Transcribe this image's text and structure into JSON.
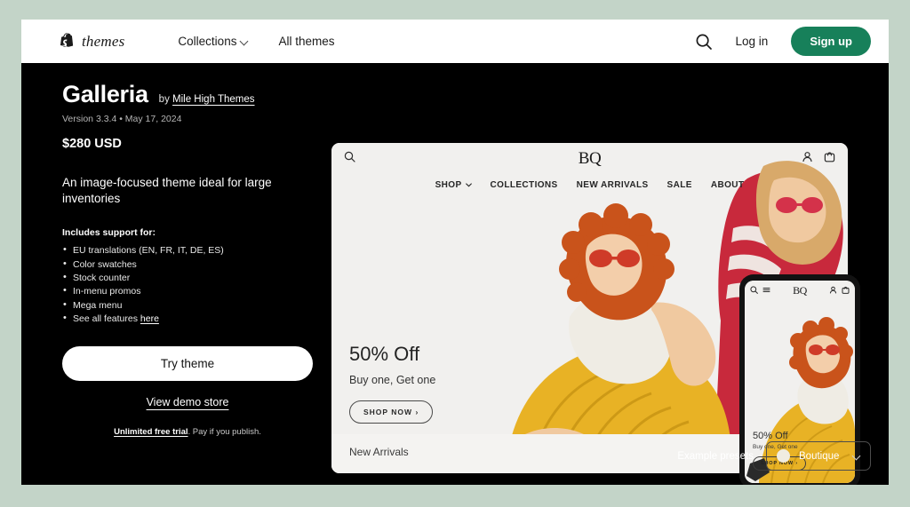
{
  "header": {
    "brand_word": "themes",
    "brand_icon": "shopify-bag-icon",
    "nav": [
      {
        "label": "Collections",
        "has_chevron": true
      },
      {
        "label": "All themes",
        "has_chevron": false
      }
    ],
    "search_icon": "search-icon",
    "login_label": "Log in",
    "signup_label": "Sign up",
    "signup_color": "#17805a"
  },
  "theme": {
    "title": "Galleria",
    "by_prefix": "by",
    "author": "Mile High Themes",
    "version_line": "Version 3.3.4 • May 17, 2024",
    "price": "$280 USD",
    "tagline": "An image-focused theme ideal for large inventories",
    "supports_title": "Includes support for:",
    "features": [
      "EU translations (EN, FR, IT, DE, ES)",
      "Color swatches",
      "Stock counter",
      "In-menu promos",
      "Mega menu"
    ],
    "see_all_prefix": "See all features",
    "see_all_link": "here",
    "try_label": "Try theme",
    "demo_label": "View demo store",
    "trial_strong": "Unlimited free trial",
    "trial_rest": ". Pay if you publish."
  },
  "preview": {
    "store_logo": "BQ",
    "search_icon": "search-icon",
    "account_icon": "account-icon",
    "cart_icon": "cart-icon",
    "nav": [
      {
        "label": "SHOP",
        "has_chevron": true
      },
      {
        "label": "COLLECTIONS",
        "has_chevron": false
      },
      {
        "label": "NEW ARRIVALS",
        "has_chevron": false
      },
      {
        "label": "SALE",
        "has_chevron": false
      },
      {
        "label": "ABOUT",
        "has_chevron": false
      }
    ],
    "hero_heading": "50% Off",
    "hero_sub": "Buy one, Get one",
    "hero_cta": "SHOP NOW",
    "hero_cta_arrow": "›",
    "section_title": "New Arrivals"
  },
  "mobile_preview": {
    "store_logo": "BQ",
    "search_icon": "search-icon",
    "menu_icon": "hamburger-menu-icon",
    "account_icon": "account-icon",
    "cart_icon": "cart-icon",
    "hero_heading": "50% Off",
    "hero_sub": "Buy one, Get one",
    "hero_cta": "SHOP NOW",
    "hero_cta_arrow": "›"
  },
  "presets": {
    "label": "Example presets",
    "selected": "Boutique",
    "swatch_color": "#f0ece1",
    "chevron_icon": "chevron-down-icon"
  }
}
